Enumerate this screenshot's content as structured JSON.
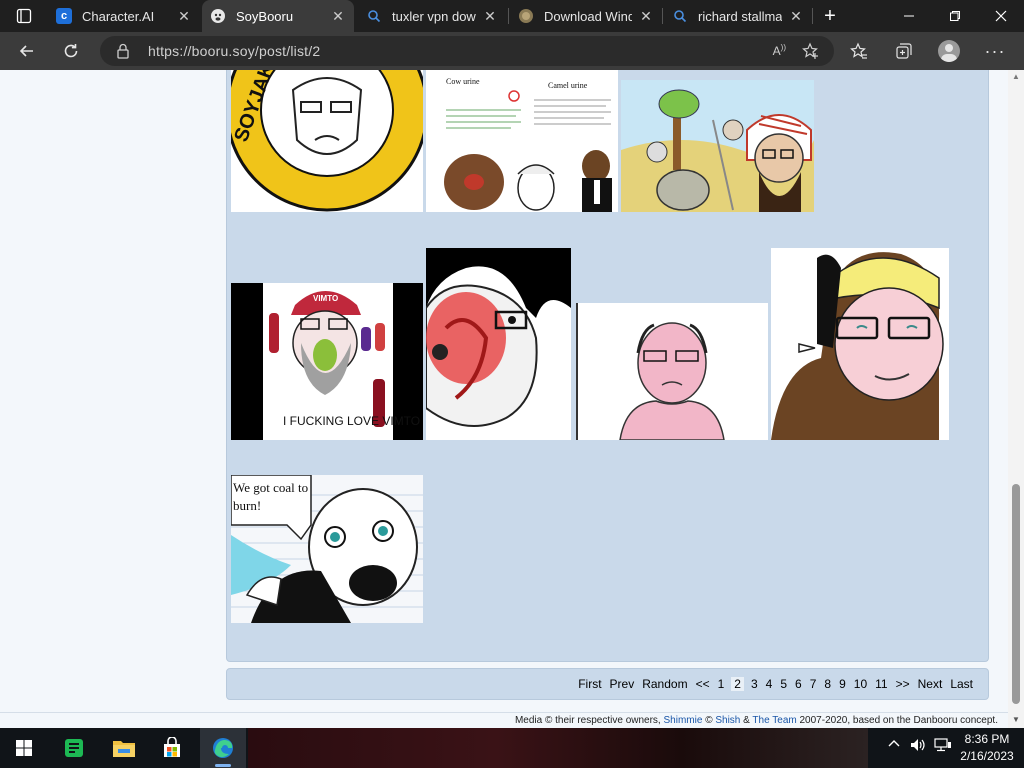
{
  "browser": {
    "tabs": [
      {
        "label": "Character.AI",
        "favicon": "character-ai-icon"
      },
      {
        "label": "SoyBooru",
        "favicon": "soybooru-icon",
        "active": true
      },
      {
        "label": "tuxler vpn down",
        "favicon": "search-icon"
      },
      {
        "label": "Download Wind",
        "favicon": "globe-icon"
      },
      {
        "label": "richard stallman",
        "favicon": "search-icon"
      }
    ],
    "address": "https://booru.soy/post/list/2",
    "read_aloud": "A",
    "window_controls": [
      "minimize",
      "maximize",
      "close"
    ]
  },
  "thumbnails": [
    {
      "name": "thumb-soyjak-party-logo",
      "logo_text": "SOYJAK PARTY",
      "colors": {
        "ring": "#f0c419",
        "bg": "#ffffff"
      }
    },
    {
      "name": "thumb-cow-camel-urine",
      "caption_left": "Cow urine",
      "caption_right": "Camel urine",
      "colors": {
        "bg": "#ffffff"
      }
    },
    {
      "name": "thumb-desert-soyjaks",
      "colors": {
        "sky": "#c8e6f5",
        "sand": "#e4d27a"
      }
    },
    {
      "name": "thumb-vimto-soyjak",
      "cap_text": "VIMTO",
      "caption": "I FUCKING LOVE VIMTO",
      "colors": {
        "cap": "#c0283c",
        "bg": "#ffffff"
      }
    },
    {
      "name": "thumb-red-face-closeup",
      "colors": {
        "red": "#e84a4a",
        "bg": "#ffffff"
      }
    },
    {
      "name": "thumb-pink-bald-soyjak",
      "colors": {
        "skin": "#f2b6c8",
        "bg": "#ffffff"
      }
    },
    {
      "name": "thumb-blonde-glasses-soyjak",
      "colors": {
        "hair": "#f5ec7a",
        "skin": "#f7cfd6",
        "neck": "#6b4423"
      }
    },
    {
      "name": "thumb-coal-soyjak",
      "caption": "We got coal to burn!",
      "colors": {
        "bg": "#f5f7fa",
        "smoke": "#7fd6e8"
      }
    }
  ],
  "pagination": {
    "first": "First",
    "prev": "Prev",
    "random": "Random",
    "prev_block": "<<",
    "pages": [
      "1",
      "2",
      "3",
      "4",
      "5",
      "6",
      "7",
      "8",
      "9",
      "10",
      "11"
    ],
    "current": "2",
    "next_block": ">>",
    "next": "Next",
    "last": "Last"
  },
  "footer": {
    "prefix": "Media © their respective owners,",
    "link1": "Shimmie",
    "mid1": "©",
    "link2": "Shish",
    "mid2": "&",
    "link3": "The Team",
    "suffix": "2007-2020, based on the Danbooru concept."
  },
  "taskbar": {
    "apps": [
      "windows-start-icon",
      "green-notes-app-icon",
      "file-explorer-icon",
      "microsoft-store-icon",
      "edge-icon"
    ],
    "time": "8:36 PM",
    "date": "2/16/2023",
    "tray": [
      "chevron-up-icon",
      "volume-icon",
      "network-icon",
      "notification-icon"
    ]
  },
  "colors": {
    "panel": "#c9d9ea",
    "link": "#1a56a8",
    "tab_bg": "#1f1f1f",
    "toolbar_bg": "#3b3b3b"
  }
}
